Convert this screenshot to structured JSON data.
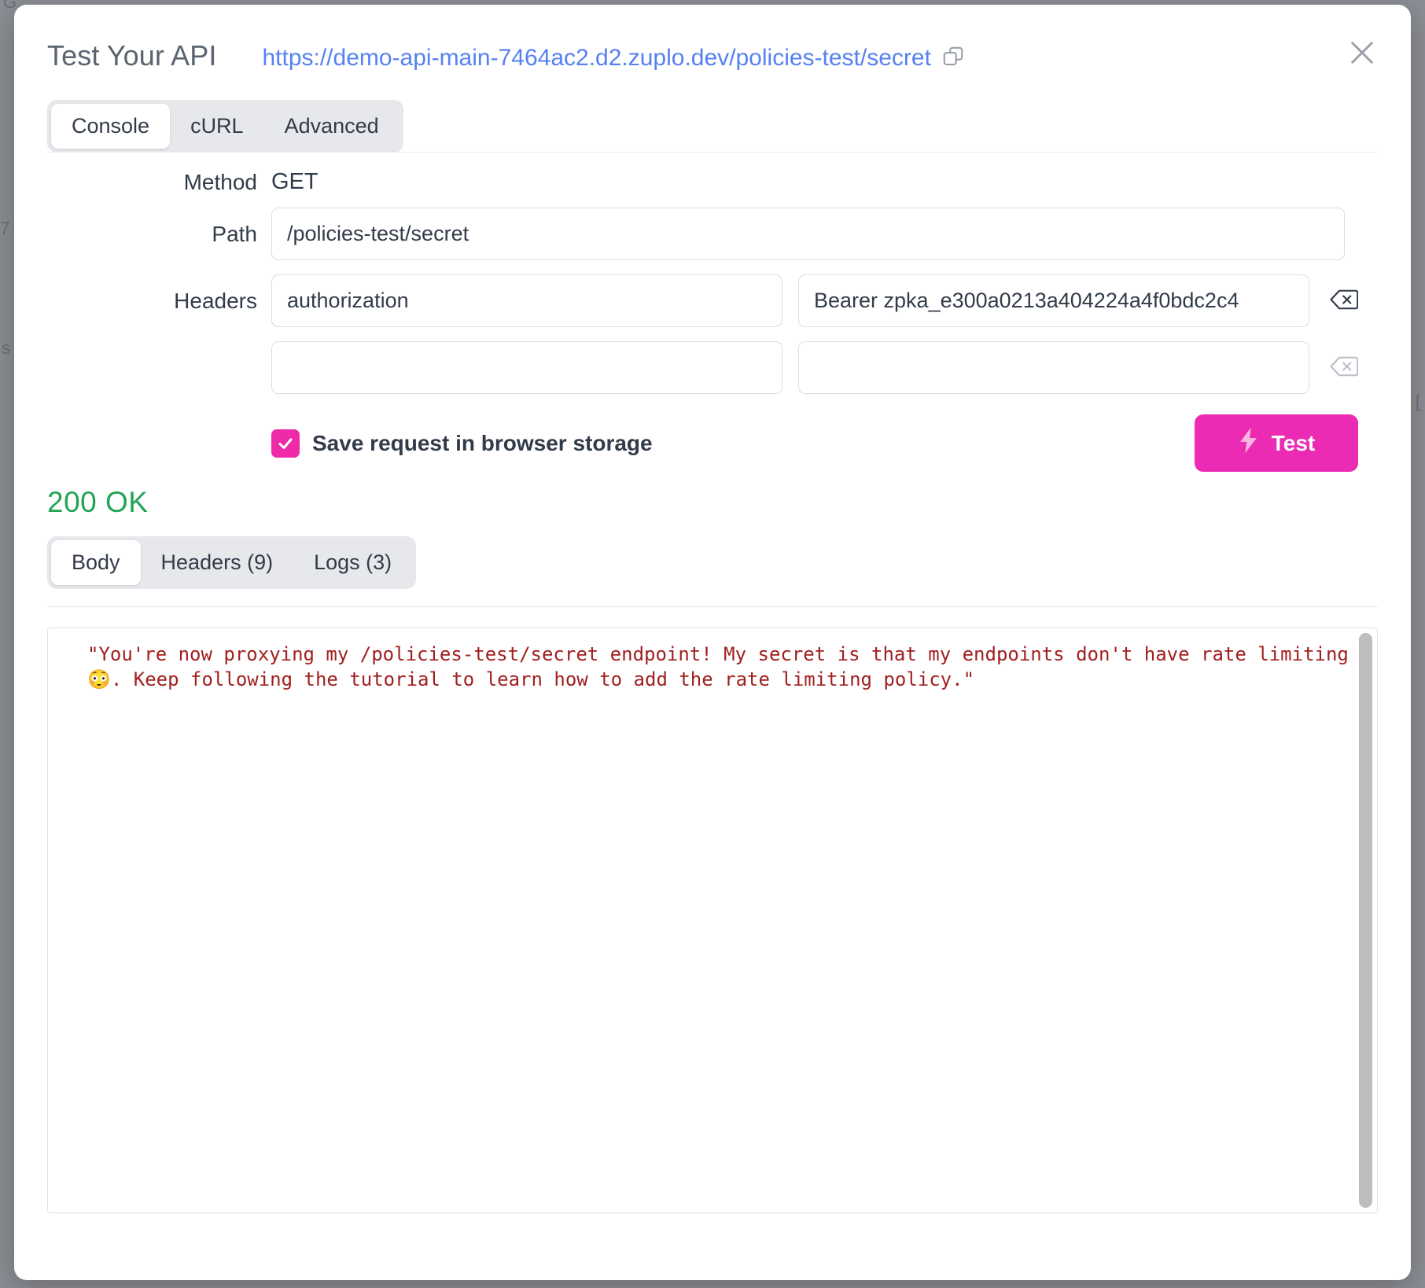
{
  "background": {
    "dim_color": "#8c8e95",
    "edge_fragments": [
      "G",
      "7",
      "s",
      "["
    ]
  },
  "header": {
    "title": "Test Your API",
    "url": "https://demo-api-main-7464ac2.d2.zuplo.dev/policies-test/secret",
    "copy_icon": "copy-icon",
    "close_icon": "close-icon"
  },
  "request_tabs": {
    "items": [
      {
        "label": "Console",
        "active": true
      },
      {
        "label": "cURL",
        "active": false
      },
      {
        "label": "Advanced",
        "active": false
      }
    ]
  },
  "form": {
    "method_label": "Method",
    "method_value": "GET",
    "path_label": "Path",
    "path_value": "/policies-test/secret",
    "path_placeholder": "",
    "headers_label": "Headers",
    "headers": [
      {
        "key": "authorization",
        "value": "Bearer zpka_e300a0213a404224a4f0bdc2c4",
        "key_placeholder": "",
        "value_placeholder": "",
        "clear_icon": "backspace-delete-icon"
      },
      {
        "key": "",
        "value": "",
        "key_placeholder": "",
        "value_placeholder": "",
        "clear_icon": "backspace-delete-icon"
      }
    ],
    "save_checkbox": {
      "label": "Save request in browser storage",
      "checked": true,
      "accent": "#ee2aa8"
    },
    "test_button": {
      "label": "Test",
      "icon": "lightning-bolt-icon",
      "color": "#ec2bb4"
    }
  },
  "response": {
    "status_text": "200 OK",
    "status_color": "#23a455",
    "tabs": [
      {
        "label": "Body",
        "active": true
      },
      {
        "label": "Headers (9)",
        "active": false
      },
      {
        "label": "Logs (3)",
        "active": false
      }
    ],
    "body_text": "\"You're now proxying my /policies-test/secret endpoint! My secret is that my endpoints don't have rate limiting 😳. Keep following the tutorial to learn how to add the rate limiting policy.\"",
    "body_color": "#a11f1f"
  }
}
